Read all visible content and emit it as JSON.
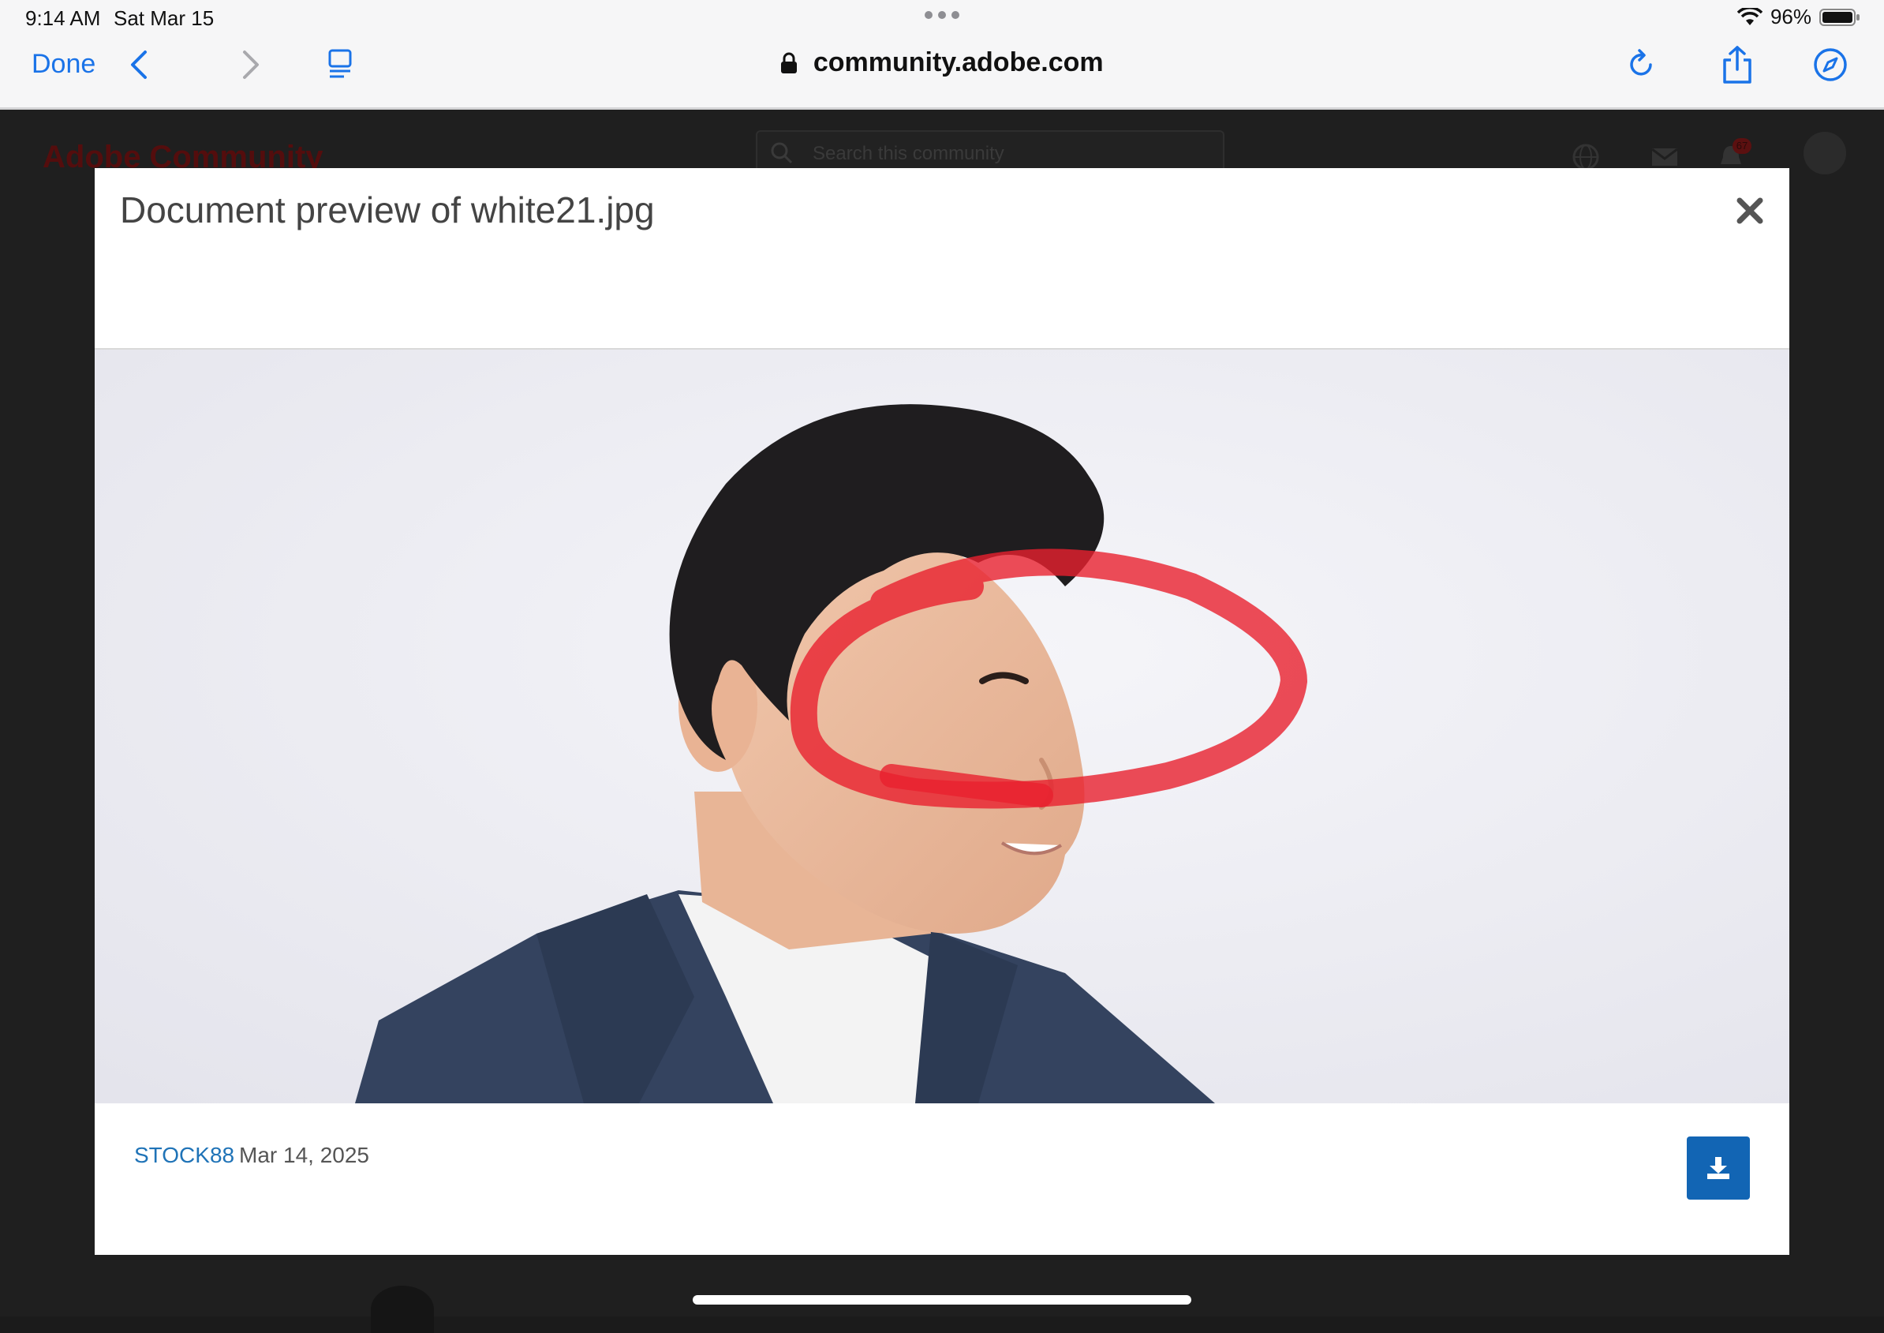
{
  "status_bar": {
    "time": "9:14 AM",
    "date": "Sat Mar 15",
    "battery": "96%"
  },
  "browser": {
    "done_label": "Done",
    "url": "community.adobe.com",
    "icons": [
      "back-icon",
      "forward-icon",
      "reader-icon",
      "reload-icon",
      "share-icon",
      "compass-icon"
    ]
  },
  "background_page": {
    "logo": "Adobe Community",
    "search_placeholder": "Search this community",
    "notification_count": "67"
  },
  "modal": {
    "title": "Document preview of white21.jpg",
    "author": "STOCK88",
    "date": "Mar 14, 2025"
  },
  "colors": {
    "link": "#1f73b7",
    "download_button": "#1265b4",
    "annotation": "#e8202e"
  }
}
